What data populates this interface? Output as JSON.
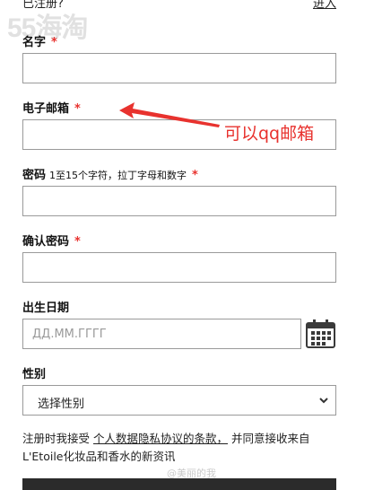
{
  "top": {
    "registered_text": "已注册?",
    "login_link": "进入",
    "watermark": "55海淘"
  },
  "fields": {
    "name": {
      "label": "名字",
      "star": "*"
    },
    "email": {
      "label": "电子邮箱",
      "star": "*"
    },
    "password": {
      "label": "密码",
      "hint": "1至15个字符，拉丁字母和数字",
      "star": "*"
    },
    "confirm": {
      "label": "确认密码",
      "star": "*"
    },
    "birthdate": {
      "label": "出生日期",
      "placeholder": "ДД.ММ.ГГГГ"
    },
    "gender": {
      "label": "性别",
      "selected": "选择性别"
    }
  },
  "annotation": {
    "text": "可以qq邮箱",
    "color": "#e8322e"
  },
  "consent": {
    "prefix": "注册时我接受",
    "link": "个人数据隐私协议的条款，",
    "suffix": "并同意接收来自L'Etoile化妆品和香水的新资讯"
  },
  "watermark_bottom": "@美丽的我",
  "icons": {
    "calendar": "calendar-icon",
    "select": "chevron-down-icon"
  }
}
